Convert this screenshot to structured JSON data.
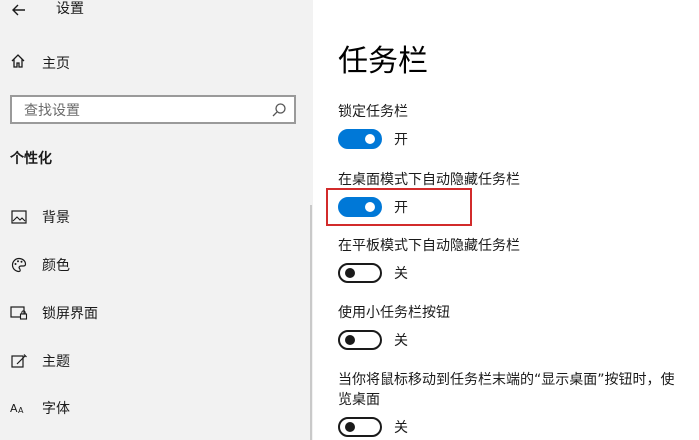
{
  "window": {
    "title": "设置"
  },
  "sidebar": {
    "home_label": "主页",
    "search_placeholder": "查找设置",
    "section_heading": "个性化",
    "items": [
      {
        "label": "背景",
        "icon": "image-icon"
      },
      {
        "label": "颜色",
        "icon": "palette-icon"
      },
      {
        "label": "锁屏界面",
        "icon": "lock-screen-icon"
      },
      {
        "label": "主题",
        "icon": "theme-icon"
      },
      {
        "label": "字体",
        "icon": "font-icon"
      }
    ]
  },
  "main": {
    "title": "任务栏",
    "settings": [
      {
        "label": "锁定任务栏",
        "state": "开",
        "on": true
      },
      {
        "label": "在桌面模式下自动隐藏任务栏",
        "state": "开",
        "on": true,
        "highlighted": true
      },
      {
        "label": "在平板模式下自动隐藏任务栏",
        "state": "关",
        "on": false
      },
      {
        "label": "使用小任务栏按钮",
        "state": "关",
        "on": false
      },
      {
        "label": "当你将鼠标移动到任务栏末端的“显示桌面”按钮时，使",
        "label_line2": "览桌面",
        "state": "关",
        "on": false
      }
    ]
  },
  "colors": {
    "accent": "#0078d7",
    "highlight": "#d22b2b",
    "sidebar_bg": "#f2f2f2"
  }
}
